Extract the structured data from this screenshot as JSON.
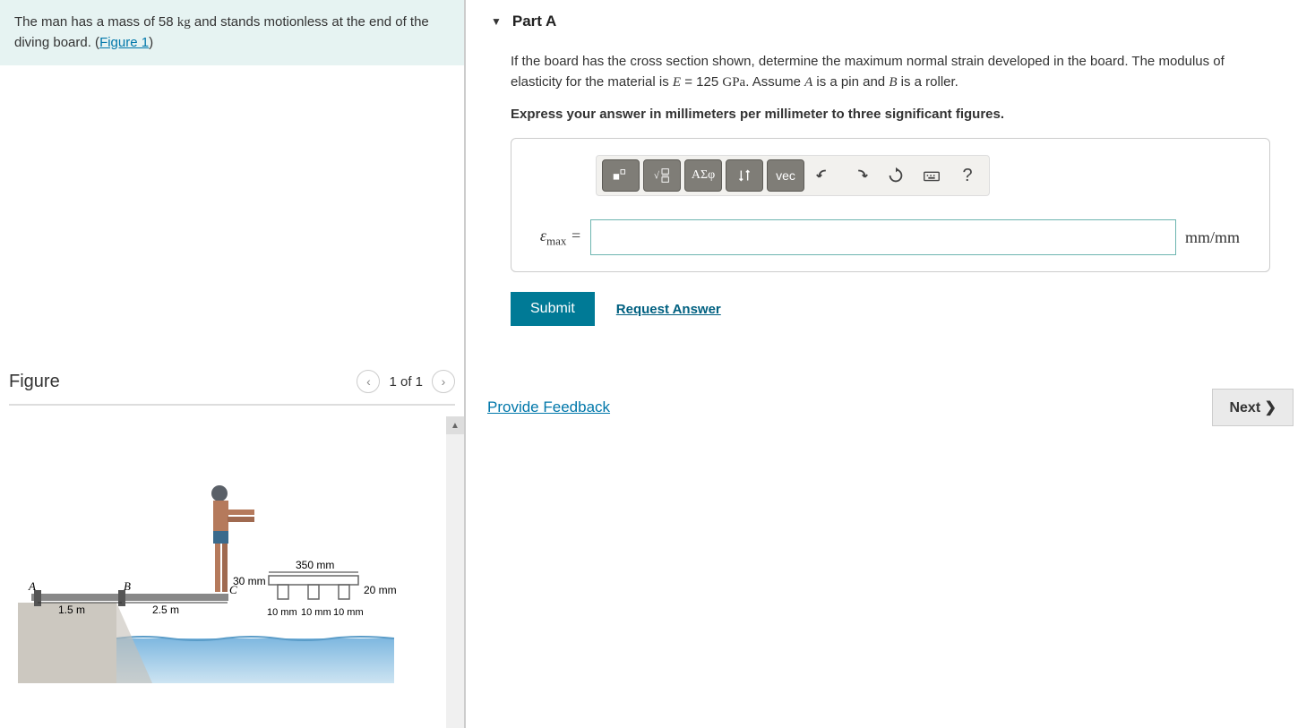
{
  "problem": {
    "statement_pre": "The man has a mass of 58 ",
    "unit_kg": "kg",
    "statement_mid": " and stands motionless at the end of the diving board. (",
    "figure_link": "Figure 1",
    "statement_post": ")"
  },
  "figure": {
    "title": "Figure",
    "nav_count": "1 of 1",
    "labels": {
      "A": "A",
      "B": "B",
      "C": "C",
      "d1": "1.5 m",
      "d2": "2.5 m",
      "w350": "350 mm",
      "h30": "30 mm",
      "t20": "20 mm",
      "s1": "10 mm",
      "s2": "10 mm",
      "s3": "10 mm"
    }
  },
  "part": {
    "label": "Part A",
    "question_1": "If the board has the cross section shown, determine the maximum normal strain developed in the board. The modulus of elasticity for the material is ",
    "E": "E",
    "eq": " = 125 ",
    "gpa": "GPa",
    "question_2": ". Assume ",
    "A": "A",
    "question_3": " is a pin and ",
    "B": "B",
    "question_4": " is a roller.",
    "instruction": "Express your answer in millimeters per millimeter to three significant figures."
  },
  "toolbar": {
    "greek": "ΑΣφ",
    "vec": "vec",
    "help": "?"
  },
  "input": {
    "var": "εmax",
    "eq": " = ",
    "value": "",
    "unit": "mm/mm"
  },
  "actions": {
    "submit": "Submit",
    "request": "Request Answer",
    "feedback": "Provide Feedback",
    "next": "Next ❯"
  }
}
